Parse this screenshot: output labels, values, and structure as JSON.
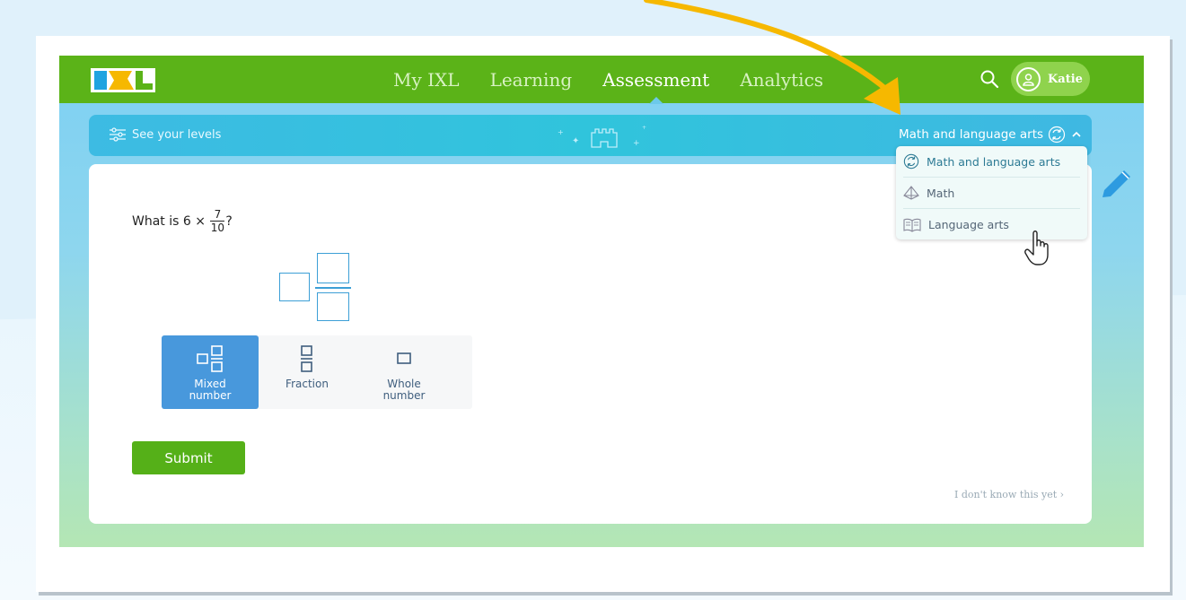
{
  "nav": {
    "logo_text": "IXL",
    "links": [
      "My IXL",
      "Learning",
      "Assessment",
      "Analytics"
    ],
    "active": "Assessment",
    "user": "Katie"
  },
  "levels_bar": {
    "see_levels": "See your levels",
    "subject": "Math and language arts"
  },
  "dropdown": {
    "items": [
      "Math and language arts",
      "Math",
      "Language arts"
    ],
    "selected": "Math and language arts"
  },
  "question": {
    "prefix": "What is 6 ×",
    "numerator": "7",
    "denominator": "10",
    "suffix": "?"
  },
  "answer_types": [
    {
      "label_line1": "Mixed",
      "label_line2": "number",
      "icon": "mixed-number-icon"
    },
    {
      "label_line1": "Fraction",
      "label_line2": "",
      "icon": "fraction-icon"
    },
    {
      "label_line1": "Whole",
      "label_line2": "number",
      "icon": "whole-number-icon"
    }
  ],
  "selected_answer_type": "Mixed number",
  "submit_label": "Submit",
  "dont_know": "I don't know this yet ›",
  "colors": {
    "nav_green": "#5bb318",
    "accent_blue": "#4898dc",
    "submit_green": "#55b018",
    "arrow_yellow": "#f6b800"
  }
}
